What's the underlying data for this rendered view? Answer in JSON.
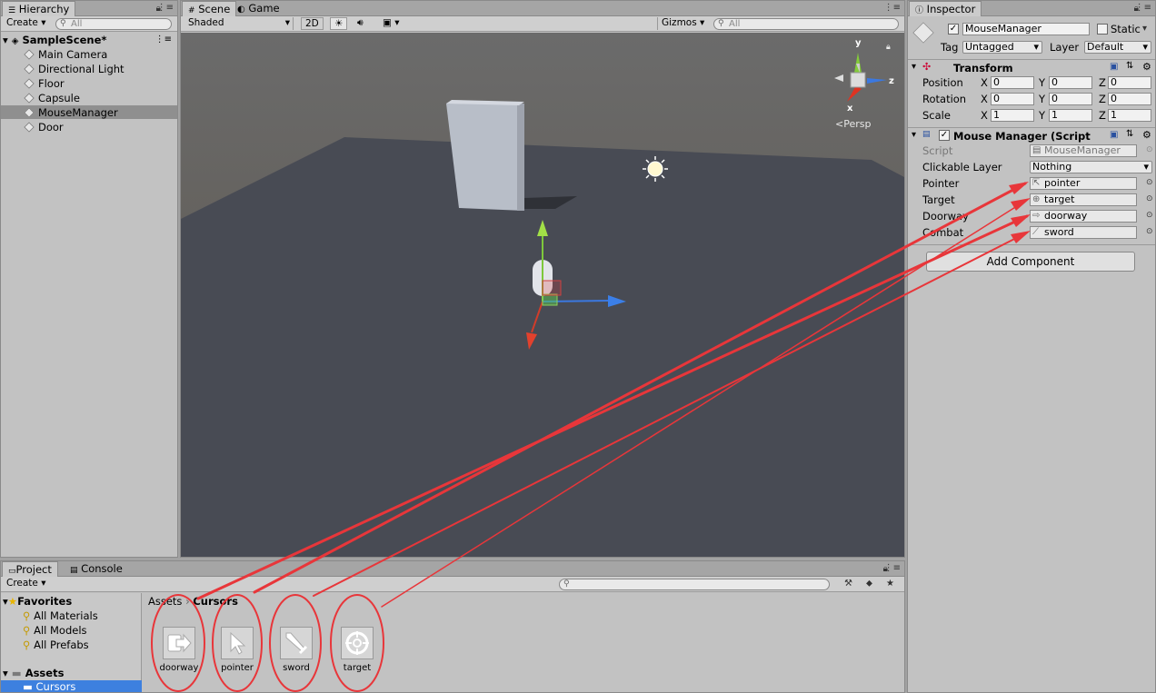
{
  "hierarchy": {
    "tab": "Hierarchy",
    "create": "Create",
    "search_placeholder": "All",
    "scene": "SampleScene*",
    "items": [
      "Main Camera",
      "Directional Light",
      "Floor",
      "Capsule",
      "MouseManager",
      "Door"
    ],
    "selected": "MouseManager"
  },
  "scene_view": {
    "tabs": [
      "Scene",
      "Game"
    ],
    "shading": "Shaded",
    "mode_2d": "2D",
    "gizmos": "Gizmos",
    "search_placeholder": "All",
    "persp": "Persp",
    "axis_y": "y",
    "axis_z": "z",
    "axis_x": "x"
  },
  "inspector": {
    "tab": "Inspector",
    "object_name": "MouseManager",
    "static": "Static",
    "tag_label": "Tag",
    "tag_value": "Untagged",
    "layer_label": "Layer",
    "layer_value": "Default",
    "transform": {
      "title": "Transform",
      "rows": [
        {
          "label": "Position",
          "x": "0",
          "y": "0",
          "z": "0"
        },
        {
          "label": "Rotation",
          "x": "0",
          "y": "0",
          "z": "0"
        },
        {
          "label": "Scale",
          "x": "1",
          "y": "1",
          "z": "1"
        }
      ],
      "x": "X",
      "y": "Y",
      "z": "Z"
    },
    "script": {
      "title": "Mouse Manager (Script",
      "script_label": "Script",
      "script_value": "MouseManager",
      "clickable_label": "Clickable Layer",
      "clickable_value": "Nothing",
      "pointer_label": "Pointer",
      "pointer_value": "pointer",
      "target_label": "Target",
      "target_value": "target",
      "doorway_label": "Doorway",
      "doorway_value": "doorway",
      "combat_label": "Combat",
      "combat_value": "sword"
    },
    "add_component": "Add Component"
  },
  "project": {
    "tabs": [
      "Project",
      "Console"
    ],
    "create": "Create",
    "favorites": "Favorites",
    "fav_items": [
      "All Materials",
      "All Models",
      "All Prefabs"
    ],
    "assets": "Assets",
    "cursors": "Cursors",
    "breadcrumb": [
      "Assets",
      "Cursors"
    ],
    "files": [
      "doorway",
      "pointer",
      "sword",
      "target"
    ]
  },
  "colors": {
    "annotation": "#e8363a",
    "selection": "#3d80df",
    "floor": "#484b54"
  }
}
